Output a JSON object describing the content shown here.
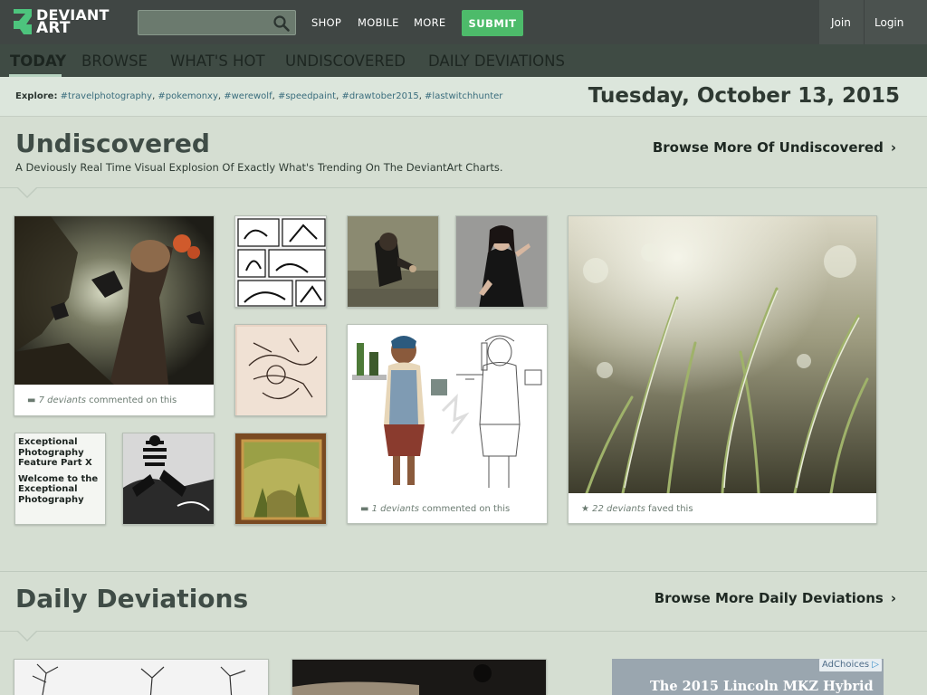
{
  "brand": {
    "line1": "DEVIANT",
    "line2": "ART"
  },
  "topnav": {
    "search_placeholder": "",
    "shop": "SHOP",
    "mobile": "MOBILE",
    "more": "MORE",
    "submit": "SUBMIT",
    "join": "Join",
    "login": "Login"
  },
  "subnav": [
    "TODAY",
    "BROWSE",
    "WHAT'S HOT",
    "UNDISCOVERED",
    "DAILY DEVIATIONS"
  ],
  "explore": {
    "label": "Explore:",
    "tags": [
      "#travelphotography",
      "#pokemonxy",
      "#werewolf",
      "#speedpaint",
      "#drawtober2015",
      "#lastwitchhunter"
    ]
  },
  "date": "Tuesday, October 13, 2015",
  "undiscovered": {
    "title": "Undiscovered",
    "description": "A Deviously Real Time Visual Explosion Of Exactly What's Trending On The DeviantArt Charts.",
    "browse_more": "Browse More Of Undiscovered",
    "card1_count": "7 deviants",
    "card1_suffix": "commented on this",
    "card2_count": "1 deviants",
    "card2_suffix": "commented on this",
    "card3_count": "22 deviants",
    "card3_suffix": "faved this",
    "text_card_line1": "Exceptional Photography Feature Part X",
    "text_card_line2": "Welcome to the Exceptional Photography"
  },
  "daily": {
    "title": "Daily Deviations",
    "browse_more": "Browse More Daily Deviations"
  },
  "ad": {
    "choices": "AdChoices",
    "headline": "The 2015 Lincoln MKZ Hybrid"
  },
  "colors": {
    "topbar": "#404644",
    "submit": "#4dbb6a",
    "page_bg": "#d5ded2",
    "accent_link": "#3a6d7d"
  }
}
